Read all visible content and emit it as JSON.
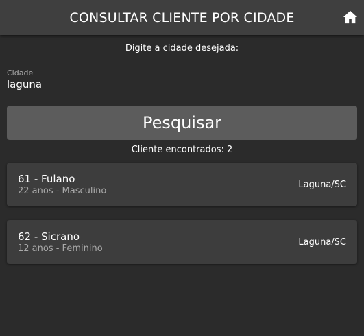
{
  "header": {
    "title": "CONSULTAR CLIENTE POR CIDADE",
    "home_icon": "home-icon"
  },
  "form": {
    "prompt": "Digite a cidade desejada:",
    "city_label": "Cidade",
    "city_value": "laguna",
    "search_button": "Pesquisar"
  },
  "results": {
    "count_text": "Cliente encontrados: 2",
    "items": [
      {
        "title": "61 - Fulano",
        "subtitle": "22 anos - Masculino",
        "city": "Laguna/SC"
      },
      {
        "title": "62 - Sicrano",
        "subtitle": "12 anos - Feminino",
        "city": "Laguna/SC"
      }
    ]
  },
  "colors": {
    "background": "#2b2b2b",
    "header": "#3f3f3f",
    "card": "#3d3d3d",
    "button": "#5c5c5c",
    "secondary_text": "#a9a9a9"
  }
}
